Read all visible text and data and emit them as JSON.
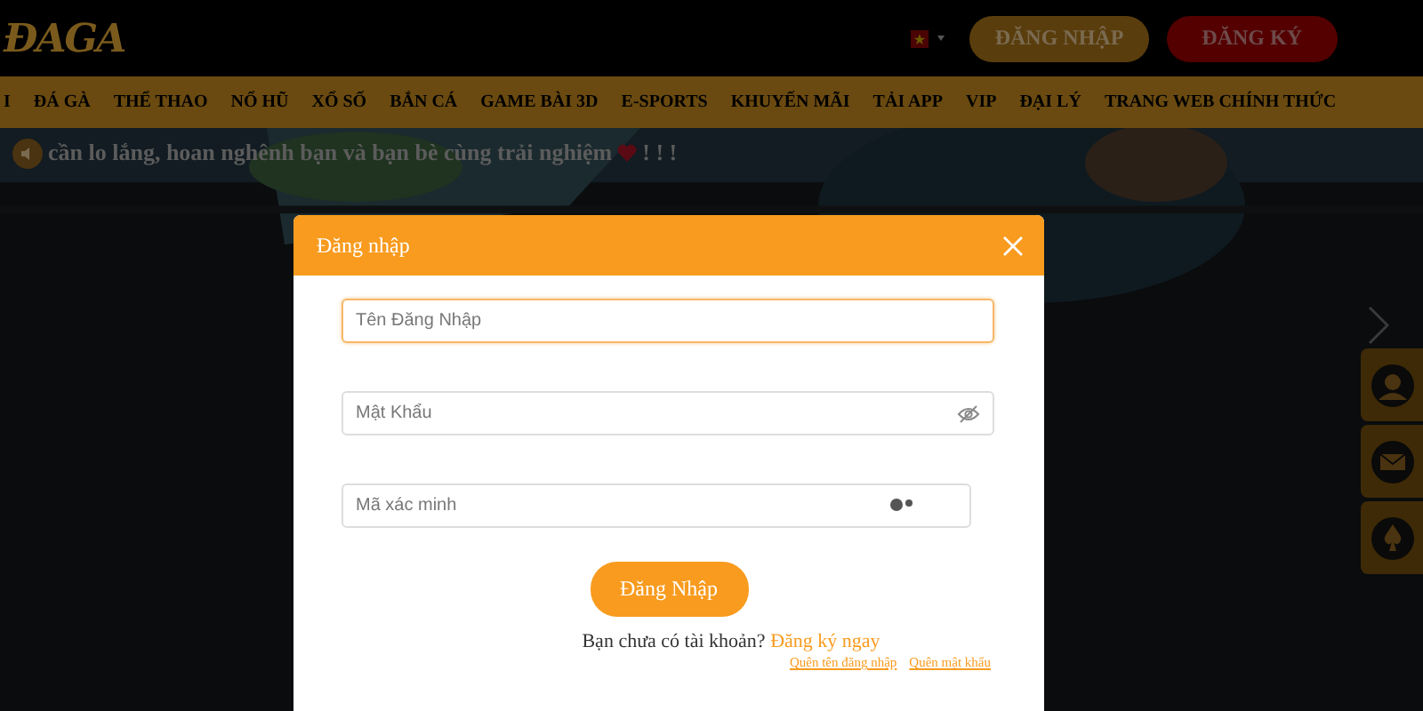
{
  "header": {
    "logo": "ĐAGA",
    "buttons": [
      {
        "label": "ĐĂNG NHẬP",
        "kind": "login"
      },
      {
        "label": "ĐĂNG KÝ",
        "kind": "register"
      }
    ]
  },
  "nav": {
    "items": [
      "I",
      "ĐÁ GÀ",
      "THỂ THAO",
      "NỔ HŨ",
      "XỔ SỐ",
      "BẮN CÁ",
      "GAME BÀI 3D",
      "E-SPORTS",
      "KHUYẾN MÃI",
      "TẢI APP",
      "VIP",
      "ĐẠI LÝ",
      "TRANG WEB CHÍNH THỨC"
    ]
  },
  "marquee": {
    "text": "cần lo lắng, hoan nghênh bạn và bạn bè cùng trải nghiệm",
    "suffix": "! ! !"
  },
  "modal": {
    "title": "Đăng nhập",
    "fields": [
      {
        "placeholder": "Tên Đăng Nhập",
        "kind": "text",
        "focused": true
      },
      {
        "placeholder": "Mật Khẩu",
        "kind": "password",
        "focused": false
      },
      {
        "placeholder": "Mã xác minh",
        "kind": "captcha",
        "focused": false
      }
    ],
    "submit": "Đăng Nhập",
    "signup_prompt": "Bạn chưa có tài khoản?",
    "signup_link": "Đăng ký ngay",
    "links": [
      "Quên tên đăng nhập",
      "Quên mật khẩu"
    ]
  }
}
